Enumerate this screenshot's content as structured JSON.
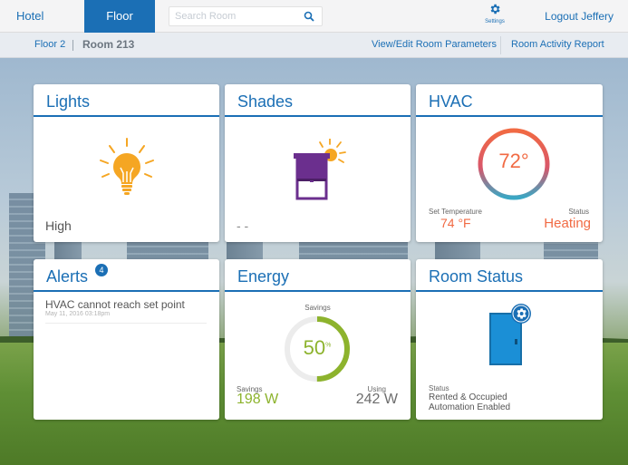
{
  "nav": {
    "hotel_label": "Hotel",
    "floor_label": "Floor",
    "search_placeholder": "Search Room",
    "settings_label": "Settings",
    "logout_label": "Logout Jeffery"
  },
  "breadcrumb": {
    "floor": "Floor 2",
    "room": "Room 213",
    "params_link": "View/Edit Room Parameters",
    "report_link": "Room Activity Report"
  },
  "lights": {
    "title": "Lights",
    "value": "High"
  },
  "shades": {
    "title": "Shades",
    "value": "- -"
  },
  "hvac": {
    "title": "HVAC",
    "current_temp": "72°",
    "set_label": "Set Temperature",
    "set_value": "74 °F",
    "status_label": "Status",
    "status_value": "Heating"
  },
  "alerts": {
    "title": "Alerts",
    "count": "4",
    "items": [
      {
        "text": "HVAC cannot reach set point",
        "time": "May 11, 2016 03:18pm"
      }
    ]
  },
  "energy": {
    "title": "Energy",
    "savings_top_label": "Savings",
    "percent": "50",
    "percent_sign": "%",
    "savings_fraction": 0.5,
    "savings_label": "Savings",
    "savings_value": "198 W",
    "using_label": "Using",
    "using_value": "242 W"
  },
  "room_status": {
    "title": "Room Status",
    "status_label": "Status",
    "line1": "Rented & Occupied",
    "line2": "Automation Enabled"
  },
  "colors": {
    "primary": "#1b6fb5",
    "orange": "#f16a43",
    "green": "#8db32d",
    "bulb": "#f5a623",
    "shade_purple": "#6b2f8e"
  }
}
